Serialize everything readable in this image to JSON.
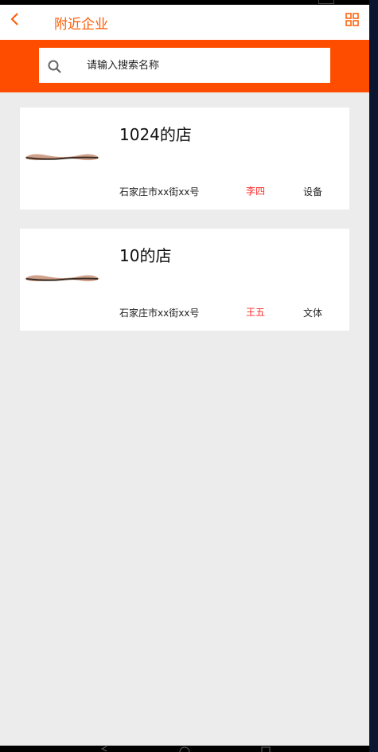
{
  "header": {
    "back_icon": "chevron-left-icon",
    "title": "附近企业",
    "menu_icon": "grid-icon"
  },
  "search": {
    "icon": "search-icon",
    "placeholder": "请输入搜索名称"
  },
  "stores": [
    {
      "name": "1024的店",
      "address": "石家庄市xx街xx号",
      "contact": "李四",
      "category": "设备"
    },
    {
      "name": "10的店",
      "address": "石家庄市xx街xx号",
      "contact": "王五",
      "category": "文体"
    }
  ],
  "colors": {
    "accent": "#ff5a00",
    "search_band": "#ff4d00",
    "contact_red": "#ff2a2a",
    "background": "#ececec"
  }
}
